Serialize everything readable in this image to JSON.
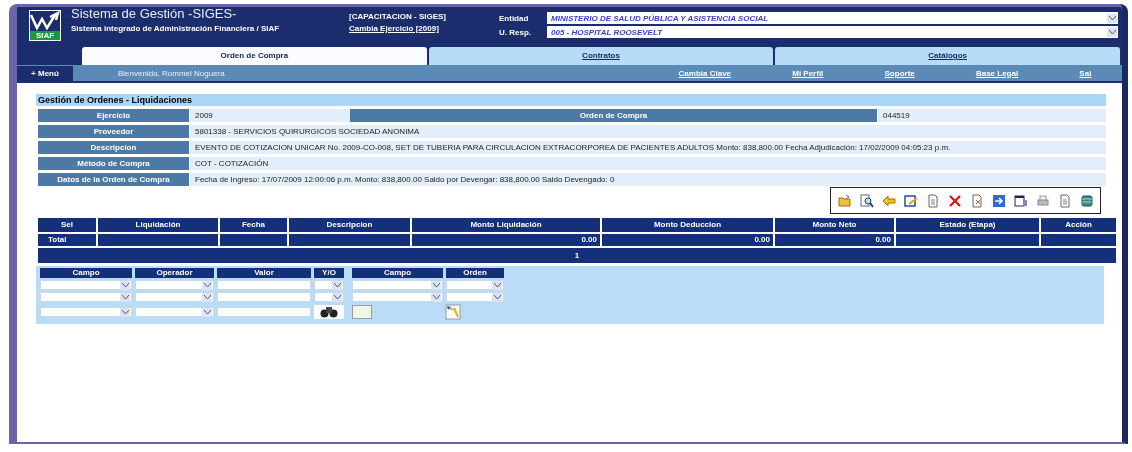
{
  "header": {
    "logo_text": "SIAF",
    "title": "Sistema de Gestión -SIGES-",
    "subtitle": "Sistema integrado de Administración Financiera / SIAF",
    "environment": "[CAPACITACION - SIGES]",
    "change_year": "Cambia Ejercicio [2009]",
    "selectors": [
      {
        "label": "Entidad",
        "value": "MINISTERIO DE SALUD PÚBLICA Y ASISTENCIA SOCIAL"
      },
      {
        "label": "U. Resp.",
        "value": "005 - HOSPITAL ROOSEVELT"
      }
    ]
  },
  "tabs": [
    {
      "label": "Orden de Compra",
      "selected": true
    },
    {
      "label": "Contratos",
      "selected": false
    },
    {
      "label": "Catálogos",
      "selected": false
    }
  ],
  "menu_bar": {
    "menu_button": "+ Menú",
    "welcome": "Bienvenido, Rommel Noguera",
    "links": [
      "Cambia Clave",
      "Mi Perfil",
      "Soporte",
      "Base Legal",
      "Sal"
    ]
  },
  "page_title": "Gestión de Ordenes - Liquidaciones",
  "info_rows": [
    {
      "kind": "pair",
      "label": "Ejercicio",
      "value": "2009",
      "label_2": "Orden de Compra",
      "value_2": "044519"
    },
    {
      "kind": "single",
      "label": "Proveedor",
      "value": "5801338 - SERVICIOS QUIRURGICOS SOCIEDAD ANONIMA"
    },
    {
      "kind": "single",
      "label": "Descripcion",
      "value": "EVENTO DE COTIZACION UNICAR No. 2009-CO-008, SET DE TUBERIA PARA CIRCULACION EXTRACORPOREA DE PACIENTES ADULTOS Monto: 838,800.00 Fecha Adjudicación: 17/02/2009 04:05:23 p.m."
    },
    {
      "kind": "single",
      "label": "Método de Compra",
      "value": "COT - COTIZACIÓN"
    },
    {
      "kind": "single",
      "label": "Datos de la Orden de Compra",
      "value": "Fecha de Ingreso: 17/07/2009 12:00:06 p.m. Monto: 838,800.00 Saldo por Devengar: 838,800.00 Saldo Devengado: 0"
    }
  ],
  "grid": {
    "columns": [
      "Sel",
      "Liquidación",
      "Fecha",
      "Descripcion",
      "Monto Liquidación",
      "Monto Deduccion",
      "Monto Neto",
      "Estado (Etapa)",
      "Acción"
    ],
    "total": {
      "label": "Total",
      "amounts": [
        "0.00",
        "0.00",
        "0.00"
      ]
    },
    "pager": "1"
  },
  "filter": {
    "headers": [
      "Campo",
      "Operador",
      "Valor",
      "Y/O",
      "Campo",
      "Orden"
    ]
  }
}
